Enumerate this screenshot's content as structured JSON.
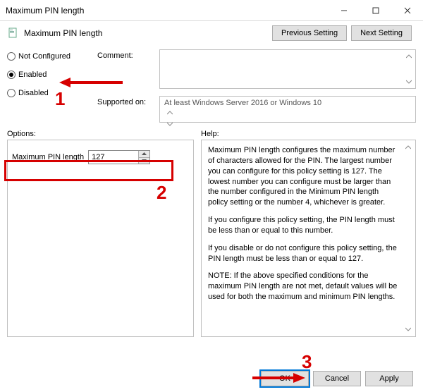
{
  "window": {
    "title": "Maximum PIN length"
  },
  "header": {
    "title": "Maximum PIN length",
    "prev": "Previous Setting",
    "next": "Next Setting"
  },
  "state": {
    "not_configured": "Not Configured",
    "enabled": "Enabled",
    "disabled": "Disabled",
    "selected": "enabled"
  },
  "labels": {
    "comment": "Comment:",
    "supported": "Supported on:",
    "options": "Options:",
    "help": "Help:"
  },
  "supported_text": "At least Windows Server 2016 or Windows 10",
  "option": {
    "label": "Maximum PIN length",
    "value": "127"
  },
  "help_paragraphs": [
    "Maximum PIN length configures the maximum number of characters allowed for the PIN.  The largest number you can configure for this policy setting is 127. The lowest number you can configure must be larger than the number configured in the Minimum PIN length policy setting or the number 4, whichever is greater.",
    "If you configure this policy setting, the PIN length must be less than or equal to this number.",
    "If you disable or do not configure this policy setting, the PIN length must be less than or equal to 127.",
    "NOTE: If the above specified conditions for the maximum PIN length are not met, default values will be used for both the maximum and minimum PIN lengths."
  ],
  "footer": {
    "ok": "OK",
    "cancel": "Cancel",
    "apply": "Apply"
  },
  "annotations": {
    "n1": "1",
    "n2": "2",
    "n3": "3"
  }
}
